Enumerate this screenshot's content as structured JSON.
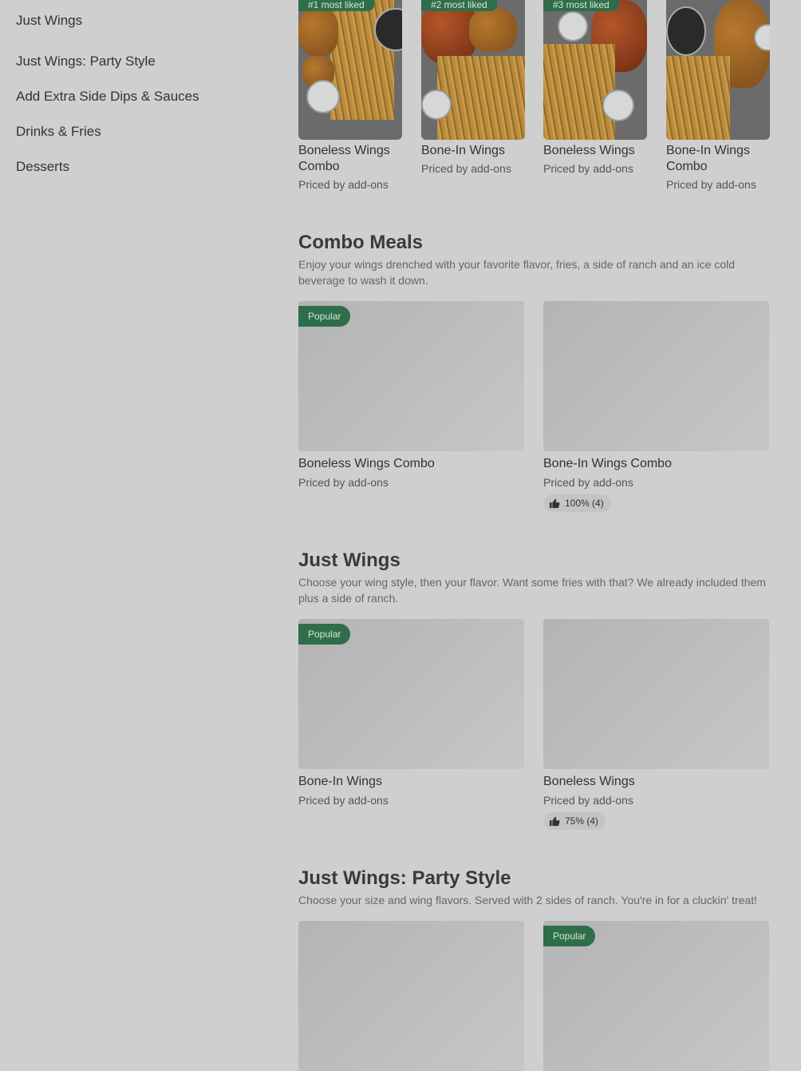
{
  "sidebar": {
    "items": [
      {
        "label": "Just Wings"
      },
      {
        "label": "Just Wings: Party Style"
      },
      {
        "label": "Add Extra Side Dips & Sauces"
      },
      {
        "label": "Drinks & Fries"
      },
      {
        "label": "Desserts"
      }
    ]
  },
  "most_liked": [
    {
      "badge": "#1 most liked",
      "title": "Boneless Wings Combo",
      "sub": "Priced by add-ons"
    },
    {
      "badge": "#2 most liked",
      "title": "Bone-In Wings",
      "sub": "Priced by add-ons"
    },
    {
      "badge": "#3 most liked",
      "title": "Boneless Wings",
      "sub": "Priced by add-ons"
    },
    {
      "badge": "",
      "title": "Bone-In Wings Combo",
      "sub": "Priced by add-ons"
    }
  ],
  "sections": [
    {
      "title": "Combo Meals",
      "desc": "Enjoy your wings drenched with your favorite flavor, fries, a side of ranch and an ice cold beverage to wash it down.",
      "items": [
        {
          "badge": "Popular",
          "title": "Boneless Wings Combo",
          "sub": "Priced by add-ons",
          "rating": ""
        },
        {
          "badge": "",
          "title": "Bone-In Wings Combo",
          "sub": "Priced by add-ons",
          "rating": "100% (4)"
        }
      ]
    },
    {
      "title": "Just Wings",
      "desc": "Choose your wing style, then your flavor. Want some fries with that? We already included them plus a side of ranch.",
      "items": [
        {
          "badge": "Popular",
          "title": "Bone-In Wings",
          "sub": "Priced by add-ons",
          "rating": ""
        },
        {
          "badge": "",
          "title": "Boneless Wings",
          "sub": "Priced by add-ons",
          "rating": "75% (4)"
        }
      ]
    },
    {
      "title": "Just Wings: Party Style",
      "desc": "Choose your size and wing flavors. Served with 2 sides of ranch. You're in for a cluckin' treat!",
      "items": [
        {
          "badge": "",
          "title": "",
          "sub": "",
          "rating": ""
        },
        {
          "badge": "Popular",
          "title": "",
          "sub": "",
          "rating": ""
        }
      ]
    }
  ],
  "colors": {
    "badge_bg": "#2f6e4a",
    "page_bg": "#cfcfcf"
  }
}
